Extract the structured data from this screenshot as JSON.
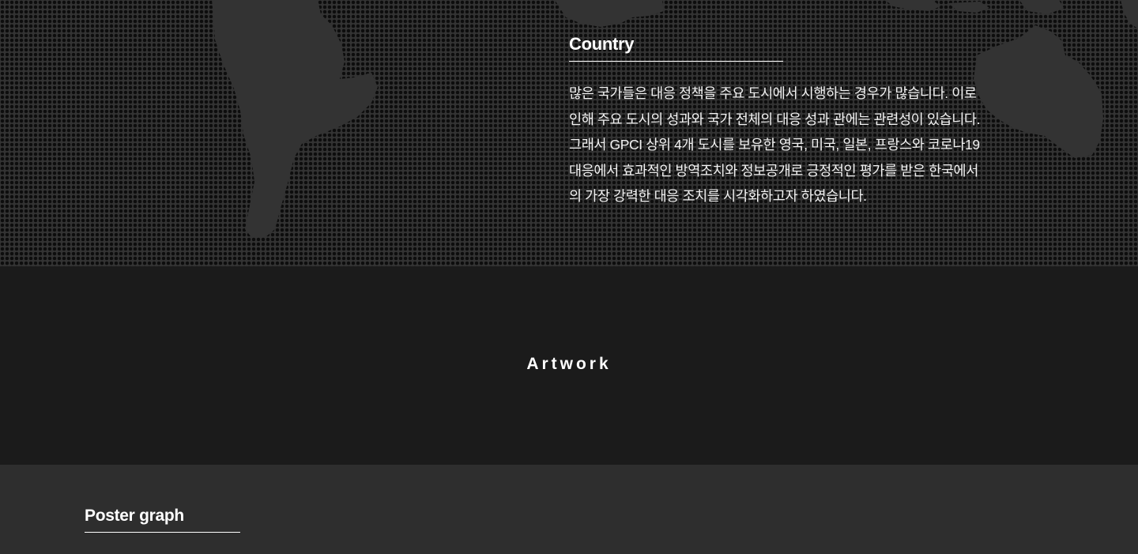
{
  "country": {
    "title": "Country",
    "paragraph_lines": [
      "많은 국가들은 대응 정책을 주요 도시에서 시행하는 경우가 많습니다. 이로",
      "인해 주요 도시의 성과와 국가  전체의 대응 성과 관에는 관련성이 있습니다.",
      "그래서 GPCI 상위 4개 도시를 보유한 영국, 미국, 일본, 프랑스와 코로나19",
      "대응에서 효과적인 방역조치와 정보공개로 긍정적인 평가를 받은 한국에서",
      "의 가장 강력한  대응 조치를 시각화하고자 하였습니다."
    ]
  },
  "artwork": {
    "title": "Artwork"
  },
  "poster": {
    "title": "Poster graph"
  },
  "colors": {
    "map_land": "#333333",
    "dots": "#0d0d0d",
    "artwork_bg": "#1b1b1b",
    "poster_bg": "#2e2e2e",
    "text": "#ffffff"
  }
}
